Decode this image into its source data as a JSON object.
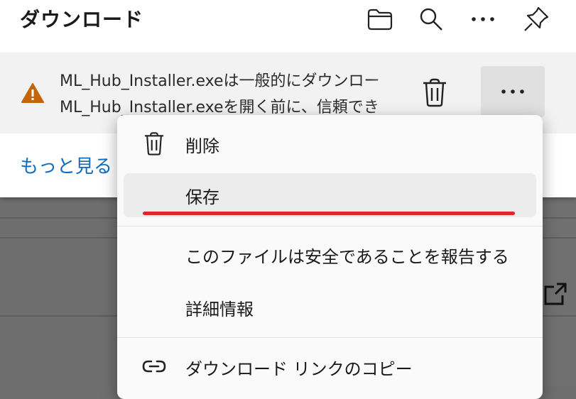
{
  "panel": {
    "title": "ダウンロード",
    "header_icons": [
      "folder-icon",
      "search-icon",
      "more-icon",
      "pin-icon"
    ],
    "show_more": "もっと見る"
  },
  "download_item": {
    "line1": "ML_Hub_Installer.exeは一般的にダウンロー",
    "line2": "ML_Hub_Installer.exeを開く前に、信頼でき",
    "warning_color": "#c4650a"
  },
  "context_menu": {
    "items": [
      {
        "label": "削除",
        "icon": "trash-icon"
      },
      {
        "label": "保存",
        "icon": ""
      },
      {
        "label": "このファイルは安全であることを報告する",
        "icon": ""
      },
      {
        "label": "詳細情報",
        "icon": ""
      },
      {
        "label": "ダウンロード リンクのコピー",
        "icon": "link-icon"
      }
    ],
    "highlight_color": "#e0262b"
  }
}
